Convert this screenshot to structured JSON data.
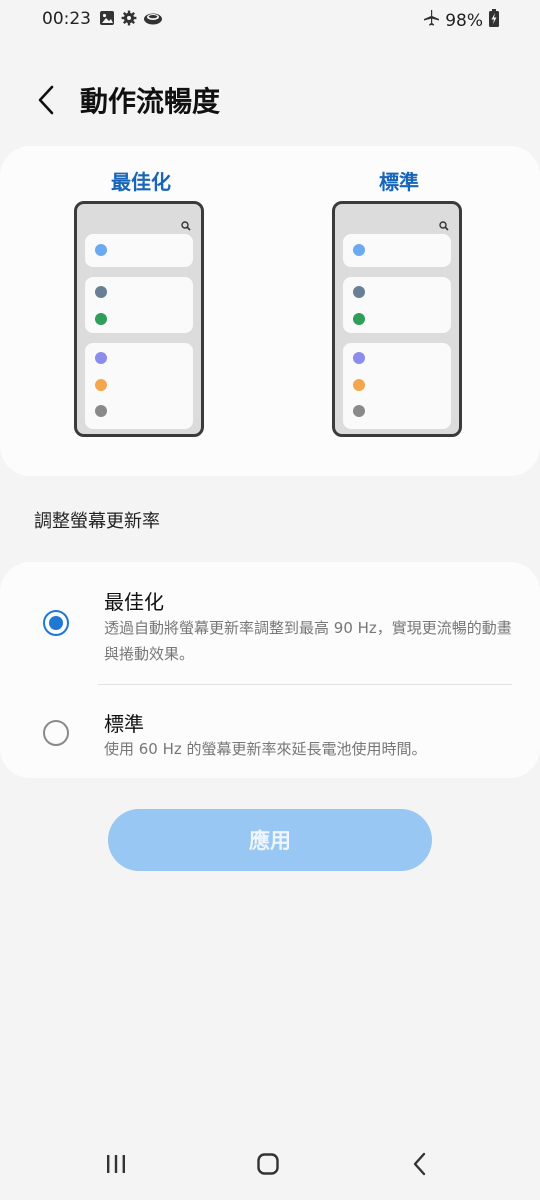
{
  "status_bar": {
    "time": "00:23",
    "icons_left": [
      "image-icon",
      "settings-icon",
      "cloud-icon"
    ],
    "battery": "98%",
    "icons_right": [
      "airplane-icon",
      "battery-charging-icon"
    ]
  },
  "header": {
    "title": "動作流暢度",
    "back_icon": "chevron-left-icon"
  },
  "preview": {
    "optimized_label": "最佳化",
    "standard_label": "標準",
    "dot_colors": [
      "#6aaaf0",
      "#687f94",
      "#2f9e5a",
      "#8c8cec",
      "#f4a64c",
      "#8a8a8a"
    ]
  },
  "section": {
    "label": "調整螢幕更新率"
  },
  "options": [
    {
      "title": "最佳化",
      "description": "透過自動將螢幕更新率調整到最高 90 Hz，實現更流暢的動畫與捲動效果。",
      "selected": true
    },
    {
      "title": "標準",
      "description": "使用 60 Hz 的螢幕更新率來延長電池使用時間。",
      "selected": false
    }
  ],
  "apply_button": {
    "label": "應用"
  },
  "colors": {
    "accent": "#1f78d1",
    "label_blue": "#1765b8",
    "apply_disabled": "#97c7f2"
  },
  "nav_bar": {
    "icons": [
      "recent-apps-icon",
      "home-icon",
      "back-icon"
    ]
  }
}
